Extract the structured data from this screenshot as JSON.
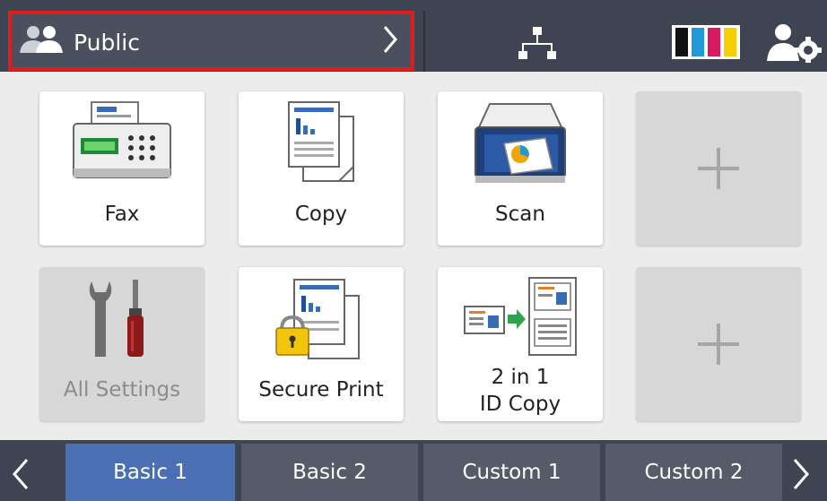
{
  "header": {
    "user_label": "Public",
    "icons": [
      "users-icon",
      "chevron-right-icon",
      "network-icon",
      "ink-cartridges-icon",
      "admin-settings-icon"
    ]
  },
  "tiles": [
    {
      "label": "Fax",
      "icon": "fax-icon",
      "enabled": true
    },
    {
      "label": "Copy",
      "icon": "copy-icon",
      "enabled": true
    },
    {
      "label": "Scan",
      "icon": "scan-icon",
      "enabled": true
    },
    {
      "label": "",
      "icon": "plus-icon",
      "enabled": false
    },
    {
      "label": "All Settings",
      "icon": "tools-icon",
      "enabled": false
    },
    {
      "label": "Secure Print",
      "icon": "secure-print-icon",
      "enabled": true
    },
    {
      "label_line1": "2 in 1",
      "label_line2": "ID Copy",
      "icon": "id-copy-icon",
      "enabled": true
    },
    {
      "label": "",
      "icon": "plus-icon",
      "enabled": false
    }
  ],
  "tabs": [
    {
      "label": "Basic 1",
      "active": true
    },
    {
      "label": "Basic 2",
      "active": false
    },
    {
      "label": "Custom 1",
      "active": false
    },
    {
      "label": "Custom 2",
      "active": false
    }
  ],
  "colors": {
    "bar": "#3e4452",
    "highlight": "#e21b1b",
    "active_tab": "#4a6fb5",
    "ink": [
      "#111111",
      "#1f9ad6",
      "#d81b60",
      "#f5d000"
    ]
  }
}
